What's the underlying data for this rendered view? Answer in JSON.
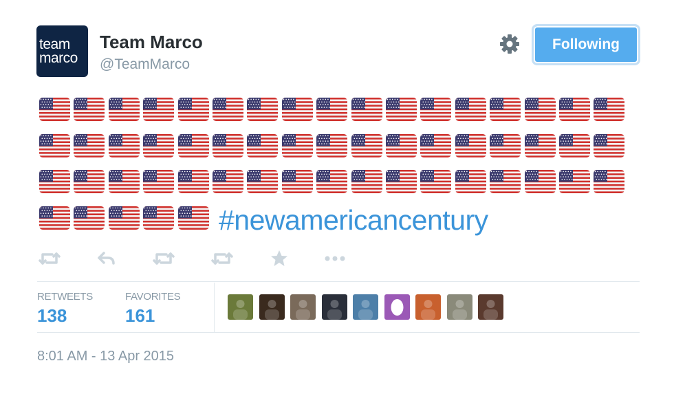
{
  "author": {
    "avatar_text_line1": "team",
    "avatar_text_line2": "marco",
    "display_name": "Team Marco",
    "handle": "@TeamMarco"
  },
  "header": {
    "settings_icon": "gear-icon",
    "follow_button_label": "Following"
  },
  "tweet": {
    "flag_emoji_count": 56,
    "flag_emoji": "🇺🇸",
    "hashtag": "#newamericancentury"
  },
  "actions": [
    {
      "name": "retweet-icon",
      "label": "Retweet"
    },
    {
      "name": "reply-icon",
      "label": "Reply"
    },
    {
      "name": "retweet-icon",
      "label": "Retweet"
    },
    {
      "name": "retweet-icon",
      "label": "Retweet"
    },
    {
      "name": "star-icon",
      "label": "Favorite"
    },
    {
      "name": "more-icon",
      "label": "More"
    }
  ],
  "stats": {
    "retweets_label": "RETWEETS",
    "retweets_value": "138",
    "favorites_label": "FAVORITES",
    "favorites_value": "161"
  },
  "favoriters": [
    {
      "color": "#6b7a3a"
    },
    {
      "color": "#3a2a1e"
    },
    {
      "color": "#7a6a5a"
    },
    {
      "color": "#2a2f3a"
    },
    {
      "color": "#4d7fa8"
    },
    {
      "color": "#9b59b6"
    },
    {
      "color": "#c8602e"
    },
    {
      "color": "#8a8a7a"
    },
    {
      "color": "#5a3a2e"
    }
  ],
  "timestamp": "8:01 AM - 13 Apr 2015",
  "colors": {
    "accent": "#55acee",
    "link": "#3b94d9",
    "muted": "#8899a6",
    "icon": "#ccd6dd"
  }
}
